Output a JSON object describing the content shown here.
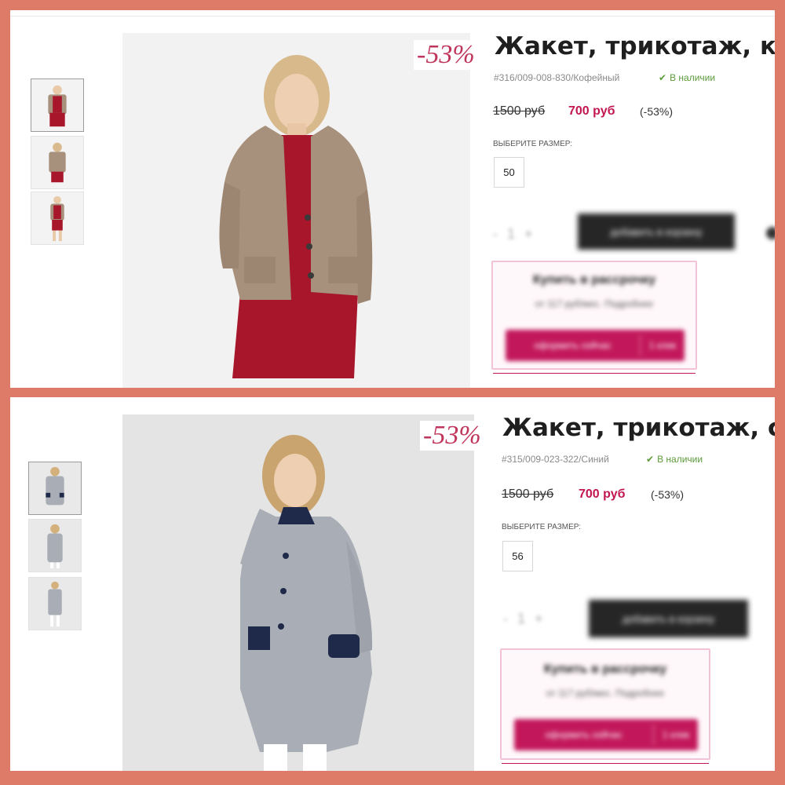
{
  "products": [
    {
      "discount_badge": "-53%",
      "title": "Жакет, трикотаж, к",
      "sku": "#316/009-008-830/Кофейный",
      "stock": "В наличии",
      "stock_icon": "check-icon",
      "old_price": "1500 руб",
      "new_price": "700 руб",
      "discount_pct": "(-53%)",
      "size_label": "ВЫБЕРИТЕ РАЗМЕР:",
      "size": "50",
      "qty_minus": "-",
      "qty_value": "1",
      "qty_plus": "+",
      "cart_button": "добавить в корзину",
      "credit_title": "Купить в рассрочку",
      "credit_sub": "от 117 руб/мес. Подробнее",
      "credit_button": "оформить сейчас",
      "credit_side": "1 клик",
      "colors": {
        "jacket": "#a8917c",
        "dress": "#a7162a"
      }
    },
    {
      "discount_badge": "-53%",
      "title": "Жакет, трикотаж, с",
      "sku": "#315/009-023-322/Синий",
      "stock": "В наличии",
      "stock_icon": "check-icon",
      "old_price": "1500 руб",
      "new_price": "700 руб",
      "discount_pct": "(-53%)",
      "size_label": "ВЫБЕРИТЕ РАЗМЕР:",
      "size": "56",
      "qty_minus": "-",
      "qty_value": "1",
      "qty_plus": "+",
      "cart_button": "добавить в корзину",
      "credit_title": "Купить в рассрочку",
      "credit_sub": "от 117 руб/мес. Подробнее",
      "credit_button": "оформить сейчас",
      "credit_side": "1 клик",
      "colors": {
        "jacket": "#a9adb5",
        "trim": "#1f2a4a"
      }
    }
  ]
}
